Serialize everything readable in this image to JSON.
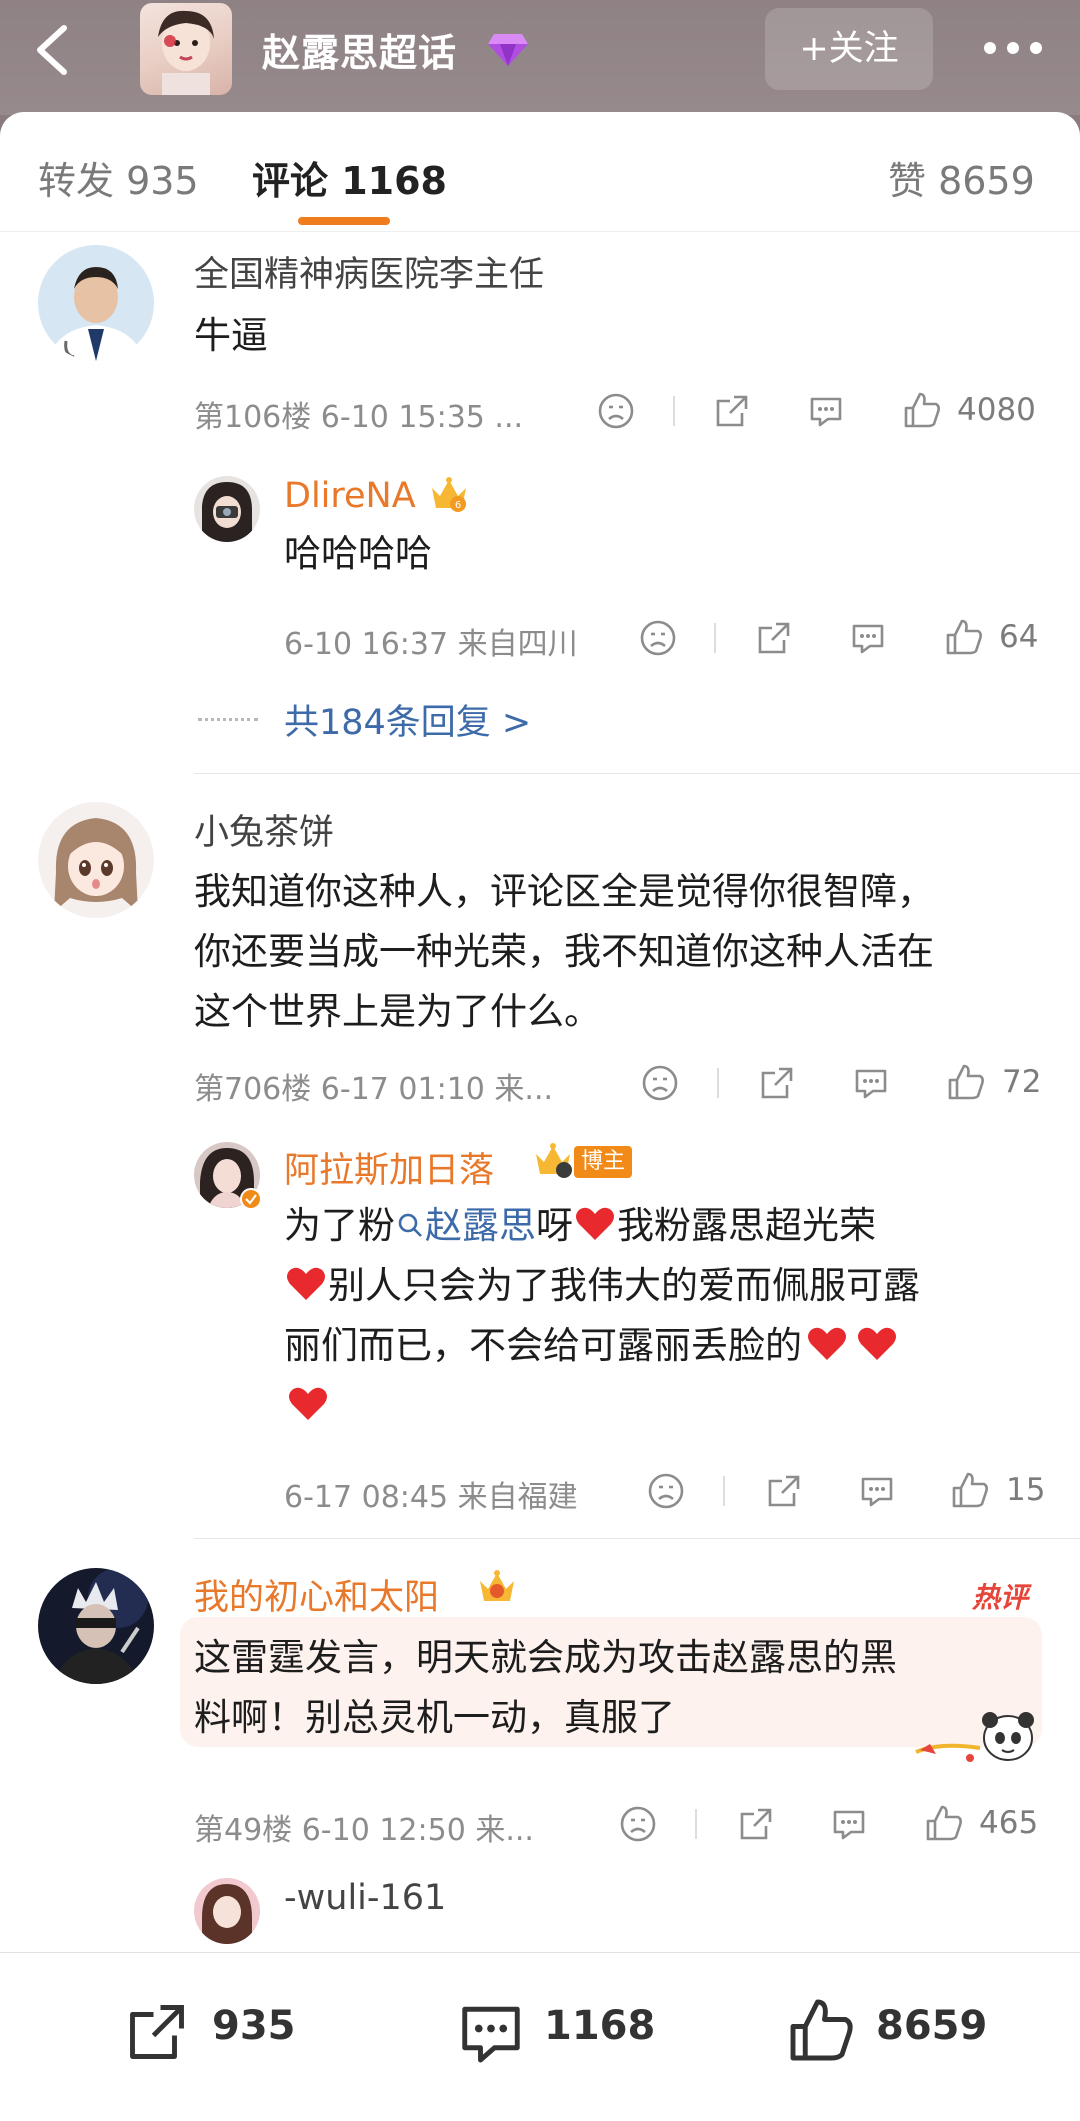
{
  "topbar": {
    "title": "赵露思超话",
    "follow_label": "+关注",
    "icons": [
      "back-chevron-icon",
      "gem-icon",
      "more-dots-icon"
    ]
  },
  "tabs": {
    "repost": "转发 935",
    "comment": "评论 1168",
    "like": "赞 8659"
  },
  "comments": [
    {
      "user": "全国精神病医院李主任",
      "text": "牛逼",
      "meta": "第106楼 6-10 15:35 ...",
      "likes": "4080",
      "replies": [
        {
          "user": "DlireNA",
          "text": "哈哈哈哈",
          "meta": "6-10 16:37 来自四川",
          "likes": "64"
        }
      ],
      "more_replies": "共184条回复 >"
    },
    {
      "user": "小兔茶饼",
      "text_lines": [
        "我知道你这种人，评论区全是觉得你很智障，",
        "你还要当成一种光荣，我不知道你这种人活在",
        "这个世界上是为了什么。"
      ],
      "meta": "第706楼 6-17 01:10 来...",
      "likes": "72",
      "replies": [
        {
          "user": "阿拉斯加日落",
          "badge": "博主",
          "line1_pre": "为了粉",
          "topic": "赵露思",
          "line1_post": "呀",
          "line1_tail": "我粉露思超光荣",
          "line2": "别人只会为了我伟大的爱而佩服可露",
          "line3": "丽们而已，不会给可露丽丢脸的",
          "meta": "6-17 08:45 来自福建",
          "likes": "15"
        }
      ]
    },
    {
      "user": "我的初心和太阳",
      "hot": "热评",
      "text_lines": [
        "这雷霆发言，明天就会成为攻击赵露思的黑",
        "料啊！别总灵机一动，真服了"
      ],
      "meta": "第49楼 6-10 12:50 来...",
      "likes": "465",
      "replies": [
        {
          "user": "-wuli-161"
        }
      ]
    }
  ],
  "bottombar": {
    "repost": "935",
    "comment": "1168",
    "like": "8659"
  },
  "colors": {
    "accent_orange": "#f07c1c",
    "link_blue": "#3d6aa8",
    "hot_red": "#e5453a",
    "heart_red": "#e8292d"
  }
}
